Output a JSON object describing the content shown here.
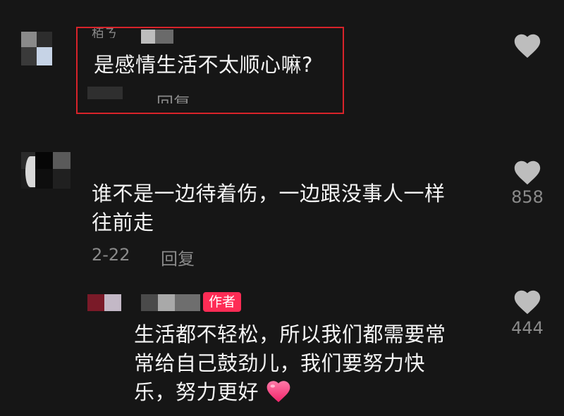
{
  "comments": [
    {
      "partial_name": "栢ㄋ",
      "text": "是感情生活不太顺心嘛?",
      "reply_label": "回复"
    },
    {
      "text": "谁不是一边待着伤，一边跟没事人一样往前走",
      "text_line1": "谁不是一边待着伤，一边跟没事人一样",
      "text_line2": "往前走",
      "date": "2-22",
      "reply_label": "回复",
      "like_count": "858"
    },
    {
      "author_badge": "作者",
      "text_line1": "生活都不轻松，所以我们都需要常",
      "text_line2": "常给自己鼓劲儿，我们要努力快",
      "text_line3": "乐，努力更好",
      "like_count": "444"
    }
  ],
  "colors": {
    "background": "#161616",
    "highlight": "#d8232a",
    "badge": "#fe2c55",
    "heart": "#bdbdbd",
    "emoji_heart": "#ff3d7f"
  },
  "icons": [
    "heart-icon",
    "heart-emoji-icon"
  ]
}
